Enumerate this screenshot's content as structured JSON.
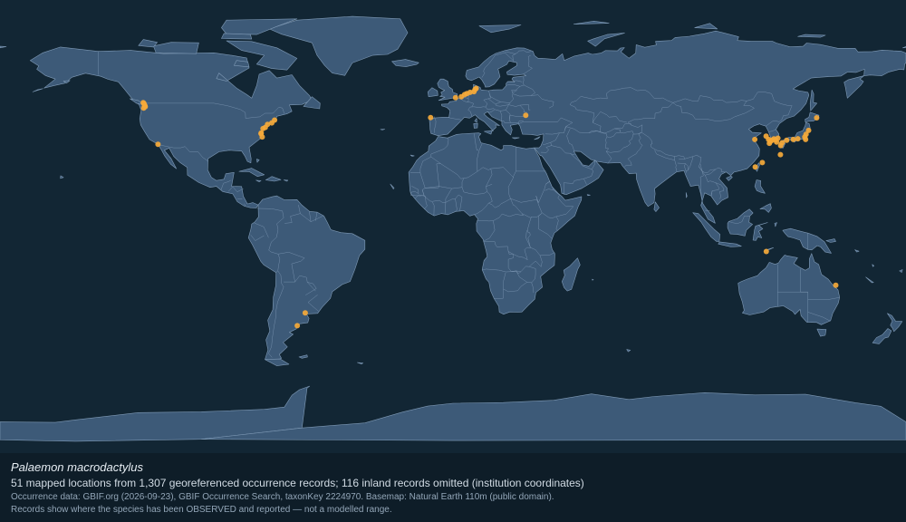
{
  "caption": {
    "species": "Palaemon macrodactylus",
    "summary": "51 mapped locations from 1,307 georeferenced occurrence records; 116 inland records omitted (institution coordinates)",
    "source": "Occurrence data: GBIF.org (2026-09-23), GBIF Occurrence Search, taxonKey 2224970. Basemap: Natural Earth 110m (public domain).",
    "note": "Records show where the species has been OBSERVED and reported — not a modelled range."
  },
  "colors": {
    "ocean": "#122634",
    "land": "#3d5a78",
    "land_border": "#7f9ab6",
    "occurrence_point": "#f5a93a",
    "caption_background": "#0e1d28"
  },
  "map": {
    "projection": "equirectangular",
    "lon_range": [
      -180,
      180
    ],
    "lat_range": [
      -90,
      90
    ]
  },
  "occurrences": [
    {
      "lon": -123.1,
      "lat": 49.2
    },
    {
      "lon": -122.8,
      "lat": 48.9
    },
    {
      "lon": -122.6,
      "lat": 48.4
    },
    {
      "lon": -122.3,
      "lat": 47.6
    },
    {
      "lon": -122.4,
      "lat": 47.9
    },
    {
      "lon": -122.9,
      "lat": 47.1
    },
    {
      "lon": -117.2,
      "lat": 32.7
    },
    {
      "lon": -70.9,
      "lat": 42.3
    },
    {
      "lon": -72.0,
      "lat": 41.2
    },
    {
      "lon": -73.7,
      "lat": 40.6
    },
    {
      "lon": -74.6,
      "lat": 39.4
    },
    {
      "lon": -75.5,
      "lat": 38.9
    },
    {
      "lon": -76.2,
      "lat": 37.2
    },
    {
      "lon": -76.3,
      "lat": 36.9
    },
    {
      "lon": -75.8,
      "lat": 35.6
    },
    {
      "lon": -8.9,
      "lat": 43.3
    },
    {
      "lon": 1.0,
      "lat": 51.2
    },
    {
      "lon": 3.3,
      "lat": 51.6
    },
    {
      "lon": 4.6,
      "lat": 52.4
    },
    {
      "lon": 5.5,
      "lat": 52.8
    },
    {
      "lon": 6.8,
      "lat": 53.3
    },
    {
      "lon": 8.3,
      "lat": 53.6
    },
    {
      "lon": 8.8,
      "lat": 54.5
    },
    {
      "lon": 9.2,
      "lat": 54.9
    },
    {
      "lon": 28.9,
      "lat": 44.2
    },
    {
      "lon": 119.9,
      "lat": 34.6
    },
    {
      "lon": 124.4,
      "lat": 35.9
    },
    {
      "lon": 125.4,
      "lat": 34.6
    },
    {
      "lon": 126.1,
      "lat": 33.8
    },
    {
      "lon": 125.7,
      "lat": 33.1
    },
    {
      "lon": 126.8,
      "lat": 34.3
    },
    {
      "lon": 127.5,
      "lat": 34.8
    },
    {
      "lon": 128.2,
      "lat": 34.5
    },
    {
      "lon": 129.1,
      "lat": 35.1
    },
    {
      "lon": 128.6,
      "lat": 33.6
    },
    {
      "lon": 130.8,
      "lat": 33.3
    },
    {
      "lon": 130.2,
      "lat": 32.2
    },
    {
      "lon": 132.6,
      "lat": 34.3
    },
    {
      "lon": 135.2,
      "lat": 34.6
    },
    {
      "lon": 137.0,
      "lat": 34.9
    },
    {
      "lon": 139.8,
      "lat": 35.6
    },
    {
      "lon": 140.3,
      "lat": 36.7
    },
    {
      "lon": 140.1,
      "lat": 34.6
    },
    {
      "lon": 144.5,
      "lat": 43.2
    },
    {
      "lon": 141.3,
      "lat": 38.2
    },
    {
      "lon": 120.1,
      "lat": 23.7
    },
    {
      "lon": 122.9,
      "lat": 25.4
    },
    {
      "lon": 130.1,
      "lat": 28.6
    },
    {
      "lon": 124.5,
      "lat": -9.9
    },
    {
      "lon": 152.1,
      "lat": -23.3
    },
    {
      "lon": -58.7,
      "lat": -34.3
    },
    {
      "lon": -61.9,
      "lat": -39.4
    }
  ]
}
